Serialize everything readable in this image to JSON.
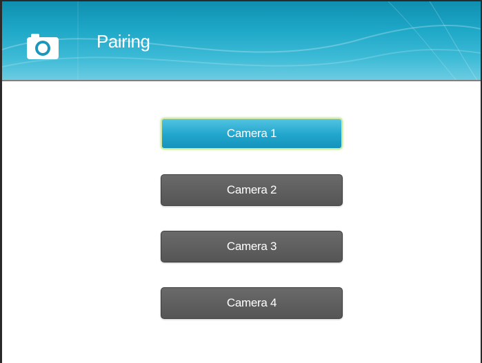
{
  "header": {
    "title": "Pairing",
    "icon": "camera-icon"
  },
  "cameras": [
    {
      "label": "Camera 1",
      "selected": true
    },
    {
      "label": "Camera 2",
      "selected": false
    },
    {
      "label": "Camera 3",
      "selected": false
    },
    {
      "label": "Camera 4",
      "selected": false
    }
  ],
  "colors": {
    "accent": "#1ea7c7",
    "button_idle": "#5f5f5f",
    "button_selected": "#21a5cc",
    "selected_border": "#cfeaa0"
  }
}
